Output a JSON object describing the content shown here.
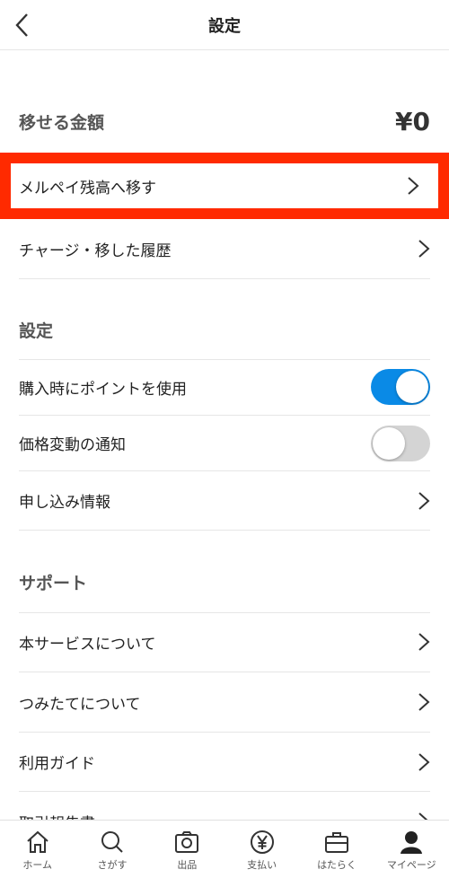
{
  "header": {
    "title": "設定"
  },
  "amount": {
    "label": "移せる金額",
    "value": "¥0"
  },
  "transfer_rows": [
    {
      "label": "メルペイ残高へ移す"
    },
    {
      "label": "チャージ・移した履歴"
    }
  ],
  "settings": {
    "title": "設定",
    "items": [
      {
        "label": "購入時にポイントを使用",
        "toggle": true
      },
      {
        "label": "価格変動の通知",
        "toggle": false
      },
      {
        "label": "申し込み情報"
      }
    ]
  },
  "support": {
    "title": "サポート",
    "items": [
      {
        "label": "本サービスについて"
      },
      {
        "label": "つみたてについて"
      },
      {
        "label": "利用ガイド"
      },
      {
        "label": "取引報告書"
      }
    ]
  },
  "colors": {
    "toggle_on": "#0a8ae6",
    "toggle_off": "#d4d4d4",
    "highlight": "#ff2a00"
  },
  "tabbar": [
    {
      "label": "ホーム",
      "icon": "home-icon"
    },
    {
      "label": "さがす",
      "icon": "search-icon"
    },
    {
      "label": "出品",
      "icon": "camera-icon"
    },
    {
      "label": "支払い",
      "icon": "yen-icon"
    },
    {
      "label": "はたらく",
      "icon": "briefcase-icon"
    },
    {
      "label": "マイページ",
      "icon": "person-icon"
    }
  ]
}
